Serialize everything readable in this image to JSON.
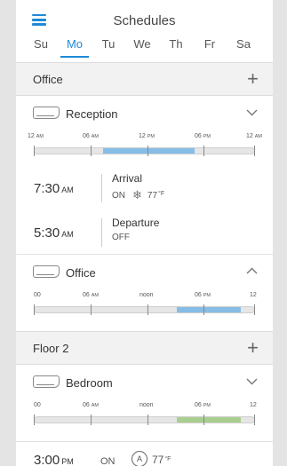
{
  "header": {
    "title": "Schedules"
  },
  "days": [
    "Su",
    "Mo",
    "Tu",
    "We",
    "Th",
    "Fr",
    "Sa"
  ],
  "active_day": "Mo",
  "groups": [
    {
      "name": "Office"
    },
    {
      "name": "Floor 2"
    }
  ],
  "rooms": {
    "reception": {
      "name": "Reception",
      "labels": [
        [
          "12",
          "AM"
        ],
        [
          "06",
          "AM"
        ],
        [
          "12",
          "PM"
        ],
        [
          "06",
          "PM"
        ],
        [
          "12",
          "AM"
        ]
      ],
      "fill_start_hour": 7.5,
      "fill_end_hour": 17.5,
      "fill_color": "#86bde6",
      "events": [
        {
          "time": "7:30",
          "ampm": "AM",
          "name": "Arrival",
          "state": "ON",
          "icon": "snowflake-sun-icon",
          "temp": "77",
          "unit": "°F"
        },
        {
          "time": "5:30",
          "ampm": "AM",
          "name": "Departure",
          "state": "OFF"
        }
      ]
    },
    "office": {
      "name": "Office",
      "labels": [
        [
          "00",
          ""
        ],
        [
          "06",
          "AM"
        ],
        [
          "noon",
          ""
        ],
        [
          "06",
          "PM"
        ],
        [
          "12",
          ""
        ]
      ],
      "fill_start_hour": 15.5,
      "fill_end_hour": 22.5,
      "fill_color": "#86bde6"
    },
    "bedroom": {
      "name": "Bedroom",
      "labels": [
        [
          "00",
          ""
        ],
        [
          "06",
          "AM"
        ],
        [
          "noon",
          ""
        ],
        [
          "06",
          "PM"
        ],
        [
          "12",
          ""
        ]
      ],
      "fill_start_hour": 15.5,
      "fill_end_hour": 22.5,
      "fill_color": "#a8cf8f",
      "events": [
        {
          "time": "3:00",
          "ampm": "PM",
          "state": "ON",
          "mode": "A",
          "temp": "77",
          "unit": "°F"
        }
      ]
    }
  },
  "colors": {
    "accent": "#1f8ad6"
  }
}
